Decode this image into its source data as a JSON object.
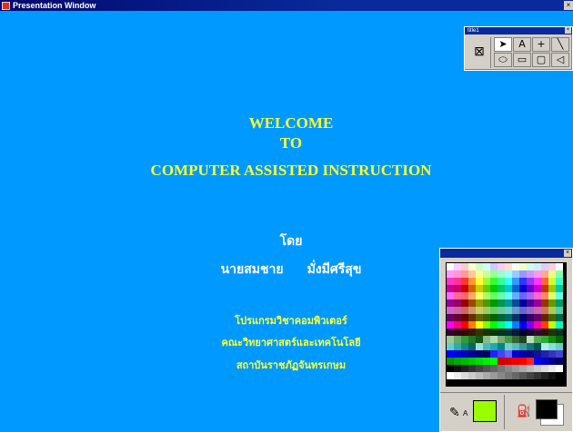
{
  "window": {
    "title": "Presentation Window",
    "close_glyph": "×"
  },
  "slide": {
    "lines": [
      "WELCOME",
      "TO",
      "COMPUTER ASSISTED INSTRUCTION"
    ],
    "by": "โดย",
    "author_first": "นายสมชาย",
    "author_last": "มั่งมีศรีสุข",
    "program": "โปรแกรมวิชาคอมพิวเตอร์",
    "faculty": "คณะวิทยาศาสตร์และเทคโนโลยี",
    "institute": "สถาบันราชภัฏจันทรเกษม",
    "colors": {
      "background": "#0099ff",
      "heading": "#ffff33",
      "text": "#ffffff"
    }
  },
  "tools_palette": {
    "title": "title1",
    "close_glyph": "×",
    "main_tool": "presentation-tool-icon",
    "tools": [
      {
        "name": "pointer-icon",
        "glyph": "➤"
      },
      {
        "name": "text-icon",
        "glyph": "A"
      },
      {
        "name": "crosshair-icon",
        "glyph": "+"
      },
      {
        "name": "line-icon",
        "glyph": "╲"
      },
      {
        "name": "ellipse-icon",
        "glyph": "⬭"
      },
      {
        "name": "rectangle-icon",
        "glyph": "▭"
      },
      {
        "name": "rounded-rectangle-icon",
        "glyph": "▢"
      },
      {
        "name": "polygon-icon",
        "glyph": "◁"
      }
    ]
  },
  "color_palette": {
    "close_glyph": "×",
    "pen_label": "A",
    "foreground_color": "#99ff00",
    "fill_foreground": "#000000",
    "fill_background": "#ffffff",
    "swatches": [
      "#ffffff",
      "#ffccff",
      "#ffcccc",
      "#ffffcc",
      "#ccffcc",
      "#ccffff",
      "#ccccff",
      "#ffccee",
      "#ffe0cc",
      "#ffffee",
      "#eeffcc",
      "#ccffee",
      "#cceeff",
      "#e0ccff",
      "#ffcce0",
      "#ffffff",
      "#ff99ff",
      "#ff99cc",
      "#ff9999",
      "#ffcc99",
      "#ffff99",
      "#ccff99",
      "#99ff99",
      "#99ffcc",
      "#99ffff",
      "#99ccff",
      "#9999ff",
      "#cc99ff",
      "#ff99ee",
      "#ffaa88",
      "#eeff88",
      "#88ffaa",
      "#ff33cc",
      "#ff3399",
      "#ff3333",
      "#ff9933",
      "#ffff33",
      "#99ff33",
      "#33ff33",
      "#33ff99",
      "#33ffff",
      "#3399ff",
      "#3333ff",
      "#9933ff",
      "#ff33ff",
      "#ff6633",
      "#ccff33",
      "#33ffcc",
      "#cc0099",
      "#cc0066",
      "#cc0000",
      "#cc6600",
      "#cccc00",
      "#66cc00",
      "#00cc00",
      "#00cc66",
      "#00cccc",
      "#0066cc",
      "#0000cc",
      "#6600cc",
      "#cc00cc",
      "#cc3300",
      "#99cc00",
      "#00cc99",
      "#ff66ff",
      "#ff6699",
      "#ff6666",
      "#ffaa66",
      "#ffff66",
      "#aaff66",
      "#66ff66",
      "#66ffaa",
      "#66ffff",
      "#66aaff",
      "#6666ff",
      "#aa66ff",
      "#ff66cc",
      "#ff8866",
      "#ddff66",
      "#66ffdd",
      "#990099",
      "#990066",
      "#990000",
      "#994c00",
      "#999900",
      "#4c9900",
      "#009900",
      "#00994c",
      "#009999",
      "#004c99",
      "#000099",
      "#4c0099",
      "#990099",
      "#993300",
      "#669900",
      "#009966",
      "#cc66cc",
      "#cc6699",
      "#cc6666",
      "#cc9966",
      "#cccc66",
      "#99cc66",
      "#66cc66",
      "#66cc99",
      "#66cccc",
      "#6699cc",
      "#6666cc",
      "#9966cc",
      "#cc66aa",
      "#cc7755",
      "#aacc55",
      "#55ccaa",
      "#660066",
      "#660033",
      "#660000",
      "#663300",
      "#666600",
      "#336600",
      "#006600",
      "#006633",
      "#006666",
      "#003366",
      "#000066",
      "#330066",
      "#660066",
      "#662200",
      "#446600",
      "#006644",
      "#ff00ff",
      "#ff0080",
      "#ff0000",
      "#ff8000",
      "#ffff00",
      "#80ff00",
      "#00ff00",
      "#00ff80",
      "#00ffff",
      "#0080ff",
      "#0000ff",
      "#8000ff",
      "#ff00aa",
      "#ff4000",
      "#c0ff00",
      "#00ffc0",
      "#330033",
      "#330019",
      "#330000",
      "#331900",
      "#333300",
      "#193300",
      "#003300",
      "#003319",
      "#003333",
      "#001933",
      "#000033",
      "#190033",
      "#330033",
      "#331100",
      "#223300",
      "#003322",
      "#99cc99",
      "#66aa66",
      "#339933",
      "#227722",
      "#115511",
      "#88bb88",
      "#aaddaa",
      "#77aa77",
      "#449944",
      "#336633",
      "#224422",
      "#bbddbb",
      "#55aa55",
      "#33aa33",
      "#118811",
      "#006600",
      "#66cccc",
      "#33aaaa",
      "#118888",
      "#006666",
      "#99dddd",
      "#44bbbb",
      "#22aaaa",
      "#008888",
      "#77cccc",
      "#55bbbb",
      "#339999",
      "#117777",
      "#005555",
      "#aaeeee",
      "#88dddd",
      "#66cccc",
      "#0000ff",
      "#0000dd",
      "#0000bb",
      "#000099",
      "#000077",
      "#000055",
      "#2222ff",
      "#4444ff",
      "#6666ff",
      "#0000cc",
      "#0000aa",
      "#000088",
      "#111199",
      "#2222aa",
      "#3333bb",
      "#4444cc",
      "#009900",
      "#00aa00",
      "#00bb00",
      "#00cc00",
      "#00dd00",
      "#00ee00",
      "#00ff00",
      "#cc0000",
      "#dd0000",
      "#ee0000",
      "#ff0000",
      "#ff2222",
      "#0000ff",
      "#0000cc",
      "#000099",
      "#000066",
      "#000000",
      "#111111",
      "#222222",
      "#333333",
      "#444444",
      "#555555",
      "#666666",
      "#777777",
      "#888888",
      "#999999",
      "#aaaaaa",
      "#bbbbbb",
      "#cccccc",
      "#dddddd",
      "#eeeeee",
      "#ffffff",
      "#ffffff",
      "#eeeeee",
      "#dddddd",
      "#cccccc",
      "#bbbbbb",
      "#aaaaaa",
      "#999999",
      "#888888",
      "#777777",
      "#666666",
      "#555555",
      "#444444",
      "#333333",
      "#222222",
      "#111111",
      "#000000"
    ]
  }
}
